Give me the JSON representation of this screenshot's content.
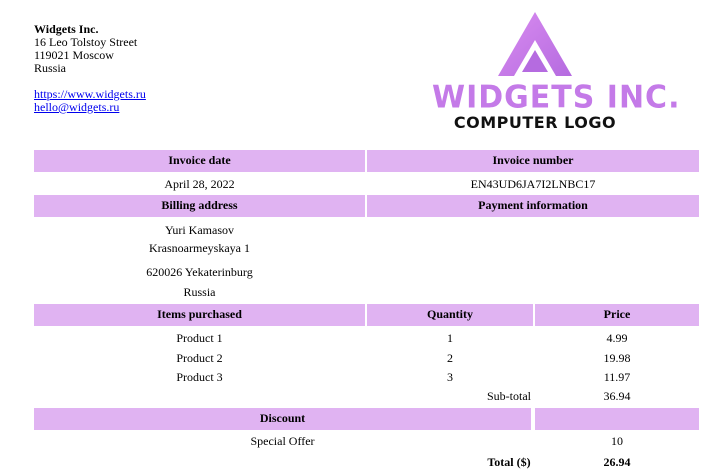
{
  "company": {
    "name": "Widgets Inc.",
    "street": "16 Leo Tolstoy Street",
    "city": "119021 Moscow",
    "country": "Russia",
    "website": "https://www.widgets.ru",
    "email": "hello@widgets.ru"
  },
  "logo": {
    "title": "WIDGETS INC.",
    "subtitle": "COMPUTER LOGO",
    "color_primary": "#c47ae8",
    "color_dark": "#111111",
    "icon": "triangle-a-icon"
  },
  "colors": {
    "header_bg": "#e0b3f2",
    "link": "#0000ee"
  },
  "invoice": {
    "date_label": "Invoice date",
    "date": "April 28, 2022",
    "number_label": "Invoice number",
    "number": "EN43UD6JA7I2LNBC17"
  },
  "billing": {
    "label": "Billing address",
    "name": "Yuri Kamasov",
    "street": "Krasnoarmeyskaya 1",
    "city": "620026 Yekaterinburg",
    "country": "Russia"
  },
  "payment": {
    "label": "Payment information"
  },
  "items": {
    "headers": {
      "item": "Items purchased",
      "quantity": "Quantity",
      "price": "Price"
    },
    "rows": [
      {
        "name": "Product 1",
        "quantity": "1",
        "price": "4.99"
      },
      {
        "name": "Product 2",
        "quantity": "2",
        "price": "19.98"
      },
      {
        "name": "Product 3",
        "quantity": "3",
        "price": "11.97"
      }
    ],
    "subtotal_label": "Sub-total",
    "subtotal": "36.94"
  },
  "discount": {
    "label": "Discount",
    "name": "Special Offer",
    "amount": "10"
  },
  "total": {
    "label": "Total ($)",
    "amount": "26.94"
  }
}
